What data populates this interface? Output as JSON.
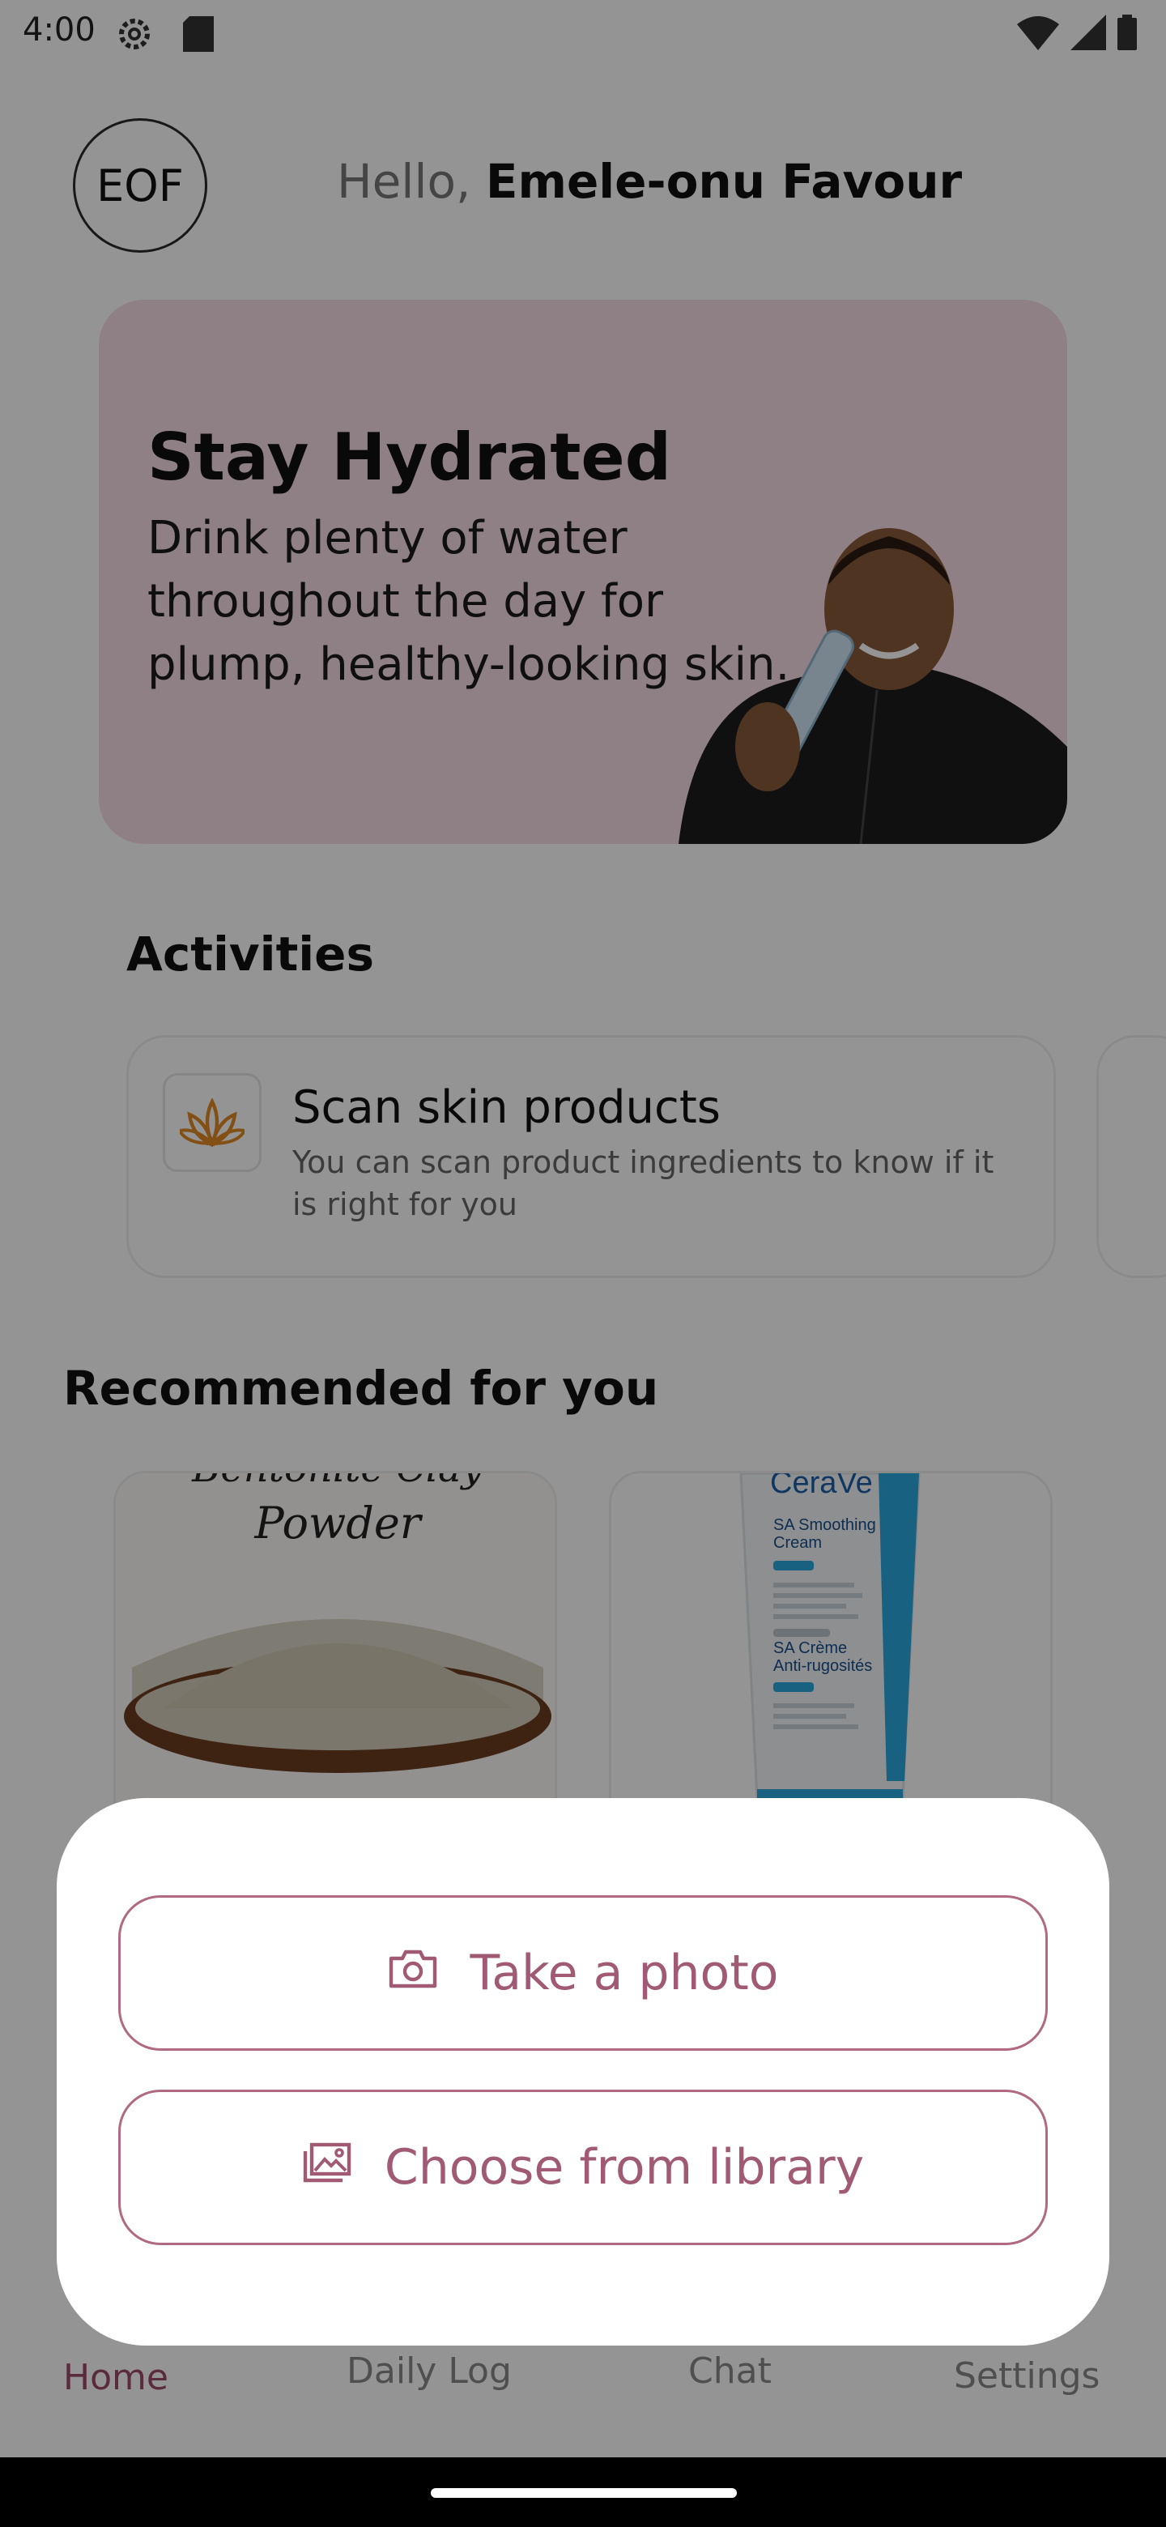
{
  "status_bar": {
    "time": "4:00"
  },
  "header": {
    "avatar_initials": "EOF",
    "greeting_prefix": "Hello,",
    "user_name": "Emele-onu Favour"
  },
  "hero": {
    "title": "Stay Hydrated",
    "text": "Drink plenty of water throughout the day for plump, healthy-looking skin."
  },
  "activities": {
    "title": "Activities",
    "cards": [
      {
        "icon": "lotus-icon",
        "title": "Scan skin products",
        "description": "You can scan product ingredients to know if it is right for you"
      }
    ]
  },
  "recommended": {
    "title": "Recommended for you",
    "products": [
      {
        "image_text_top": "Bentonite Clay",
        "image_text": "Powder"
      },
      {
        "brand": "CeraVe",
        "line1": "SA Smoothing",
        "line2": "Cream",
        "line3": "SA Crème",
        "line4": "Anti-rugosités"
      }
    ]
  },
  "bottom_nav": {
    "items": [
      {
        "label": "Home",
        "active": true
      },
      {
        "label": "Daily Log",
        "active": false
      },
      {
        "label": "Chat",
        "active": false
      },
      {
        "label": "Settings",
        "active": false
      }
    ]
  },
  "sheet": {
    "take_photo_label": "Take a photo",
    "choose_library_label": "Choose from library"
  },
  "colors": {
    "accent": "#a05a74",
    "hero_bg": "#f6dde5",
    "overlay": "rgba(0,0,0,0.42)"
  }
}
